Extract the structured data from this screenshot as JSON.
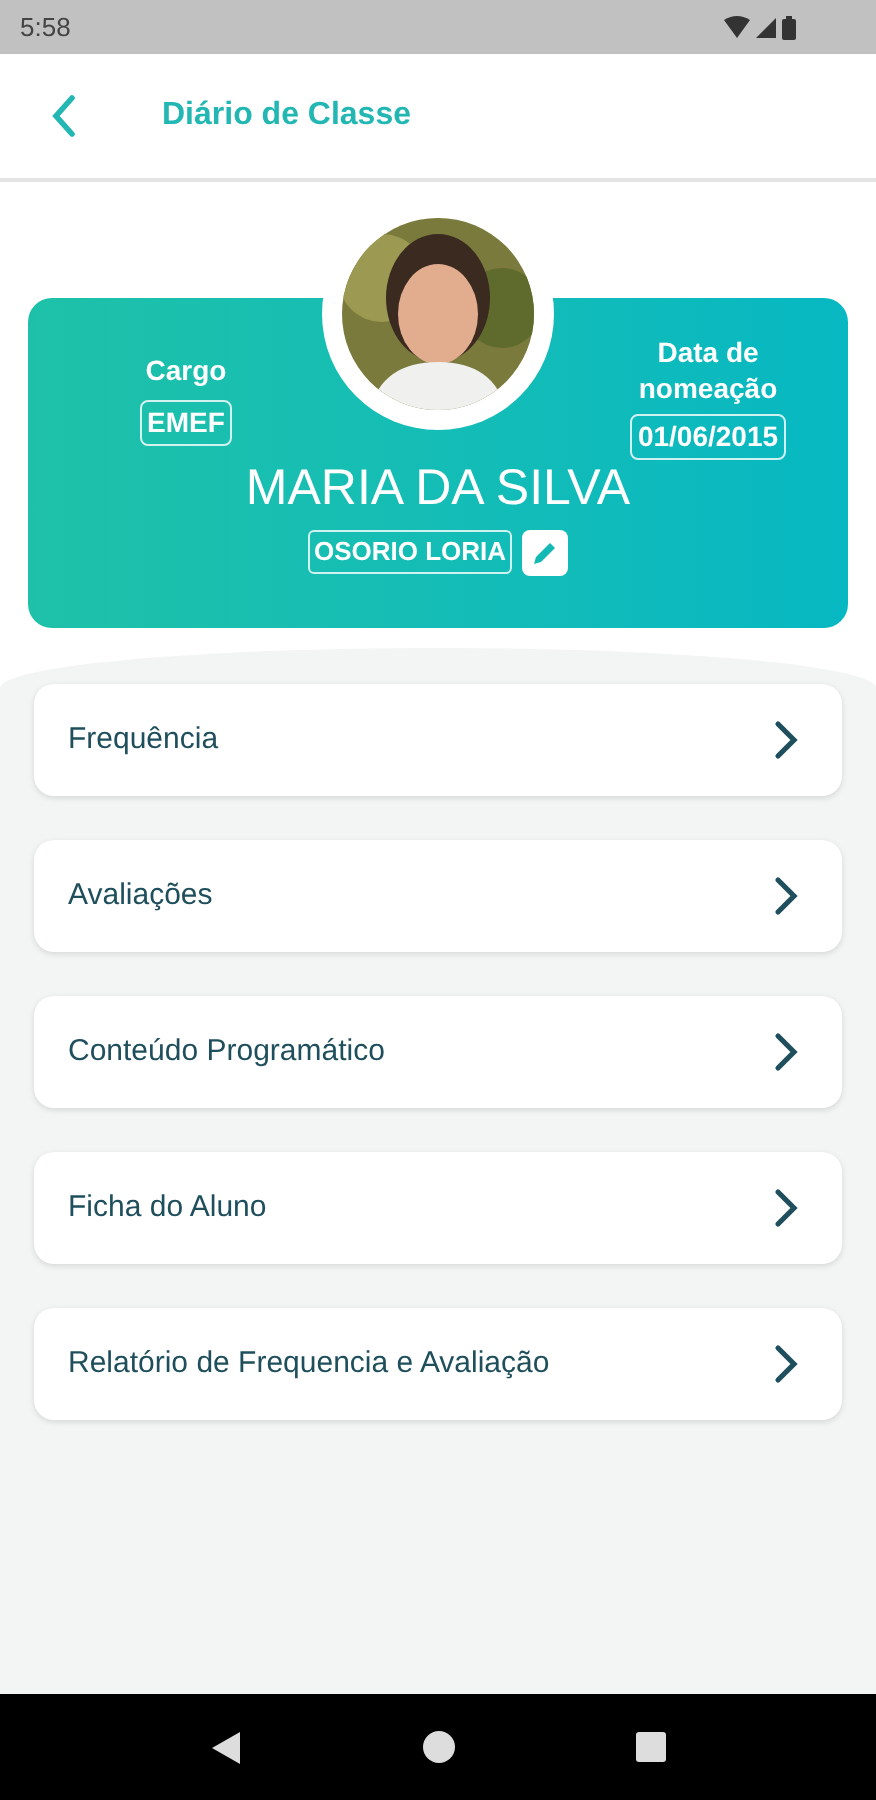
{
  "status_bar": {
    "time": "5:58"
  },
  "header": {
    "title": "Diário de Classe"
  },
  "profile": {
    "cargo_label": "Cargo",
    "cargo": "EMEF",
    "date_label": "Data de nomeação",
    "date": "01/06/2015",
    "name": "MARIA DA SILVA",
    "school": "OSORIO LORIA"
  },
  "menu": [
    {
      "label": "Frequência"
    },
    {
      "label": "Avaliações"
    },
    {
      "label": "Conteúdo Programático"
    },
    {
      "label": "Ficha do Aluno"
    },
    {
      "label": "Relatório de Frequencia e Avaliação"
    }
  ]
}
